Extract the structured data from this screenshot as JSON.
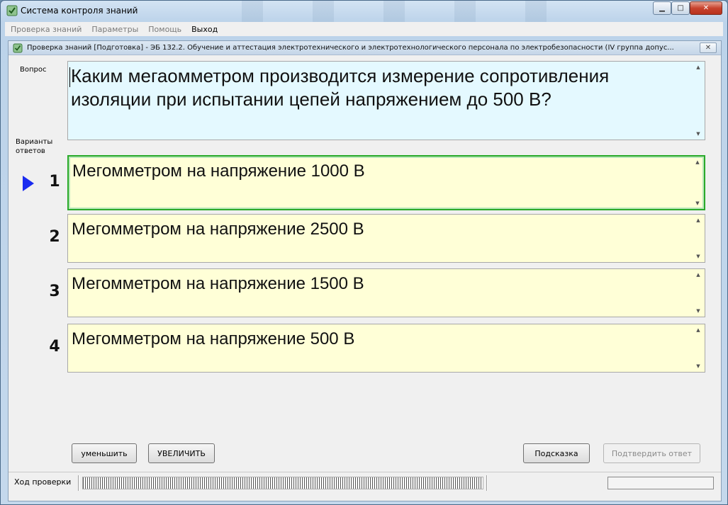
{
  "window": {
    "title": "Система контроля знаний",
    "minimize": "▁",
    "maximize": "□",
    "close": "✕"
  },
  "menu": [
    {
      "label": "Проверка знаний"
    },
    {
      "label": "Параметры"
    },
    {
      "label": "Помощь"
    },
    {
      "label": "Выход"
    }
  ],
  "inner_window": {
    "title": "Проверка знаний [Подготовка] - ЭБ 132.2. Обучение и аттестация электротехнического и электротехнологического персонала по электробезопасности (IV группа допус...",
    "close": "✕"
  },
  "labels": {
    "question": "Вопрос",
    "answers_line1": "Варианты",
    "answers_line2": "ответов",
    "progress": "Ход проверки"
  },
  "question": {
    "text": "Каким мегаомметром производится измерение сопротивления изоляции при испытании цепей напряжением до 500 В?"
  },
  "answers": [
    {
      "number": "1",
      "text": "Мегомметром на напряжение 1000 В",
      "selected": true
    },
    {
      "number": "2",
      "text": "Мегомметром на напряжение 2500 В",
      "selected": false
    },
    {
      "number": "3",
      "text": "Мегомметром на напряжение 1500 В",
      "selected": false
    },
    {
      "number": "4",
      "text": "Мегомметром на напряжение 500 В",
      "selected": false
    }
  ],
  "buttons": {
    "decrease": "уменьшить",
    "increase": "УВЕЛИЧИТЬ",
    "hint": "Подсказка",
    "confirm": "Подтвердить ответ"
  },
  "scroll": {
    "up": "▲",
    "down": "▼"
  },
  "colors": {
    "question_bg": "#e4f9ff",
    "answer_bg": "#ffffd7",
    "selected_border": "#2aaa2a",
    "pointer": "#1a2bf0"
  }
}
